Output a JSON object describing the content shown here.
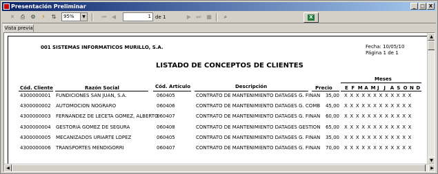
{
  "window": {
    "title": "Presentación Preliminar",
    "buttons": [
      "_",
      "□",
      "X"
    ]
  },
  "toolbar": {
    "zoom": "95%",
    "page_current": "1",
    "page_of": "de 1"
  },
  "tab": {
    "label": "Vista previa"
  },
  "report": {
    "company": "001 SISTEMAS INFORMATICOS MURILLO, S.A.",
    "fecha_label": "Fecha:",
    "fecha": "10/05/10",
    "pagina": "Página 1 de 1",
    "title": "LISTADO DE CONCEPTOS DE CLIENTES",
    "meses_label": "Meses",
    "columns": {
      "cod_cliente": "Cód. Cliente",
      "razon_social": "Razón Social",
      "cod_articulo": "Cód. Artículo",
      "descripcion": "Descripción",
      "precio": "Precio"
    },
    "months": [
      "E",
      "F",
      "M",
      "A",
      "M",
      "J",
      "J",
      "A",
      "S",
      "O",
      "N",
      "D"
    ],
    "rows": [
      {
        "cod": "4300000001",
        "razon": "FUNDICIONES SAN JUAN, S.A.",
        "art": "060405",
        "desc": "CONTRATO DE MANTENIMIENTO DATAGES G. FINAN",
        "precio": "35,00",
        "marks": "X X X X X X X X X X X X"
      },
      {
        "cod": "4300000002",
        "razon": "AUTOMOCION NOGRARO",
        "art": "060406",
        "desc": "CONTRATO DE MANTENIMIENTO DATAGES G. COMB",
        "precio": "45,00",
        "marks": "X X X X X X X X X X X X"
      },
      {
        "cod": "4300000003",
        "razon": "FERNANDEZ DE LECETA GOMEZ, ALBERTO",
        "art": "060407",
        "desc": "CONTRATO DE MANTENIMIENTO DATAGES G. FINAN",
        "precio": "60,00",
        "marks": "X X X X X X X X X X X X"
      },
      {
        "cod": "4300000004",
        "razon": "GESTORIA GOMEZ DE SEGURA",
        "art": "060408",
        "desc": "CONTRATO DE MANTENIMIENTO DATAGES GESTION",
        "precio": "65,00",
        "marks": "X X X X X X X X X X X X"
      },
      {
        "cod": "4300000005",
        "razon": "MECANIZADOS URIARTE LOPEZ",
        "art": "060405",
        "desc": "CONTRATO DE MANTENIMIENTO DATAGES G. FINAN",
        "precio": "35,00",
        "marks": "X X X X X X X X X X X X"
      },
      {
        "cod": "4300000006",
        "razon": "TRANSPORTES MENDIGORRI",
        "art": "060407",
        "desc": "CONTRATO DE MANTENIMIENTO DATAGES G. FINAN",
        "precio": "70,00",
        "marks": "X X X X X X X X X X X X"
      }
    ]
  }
}
